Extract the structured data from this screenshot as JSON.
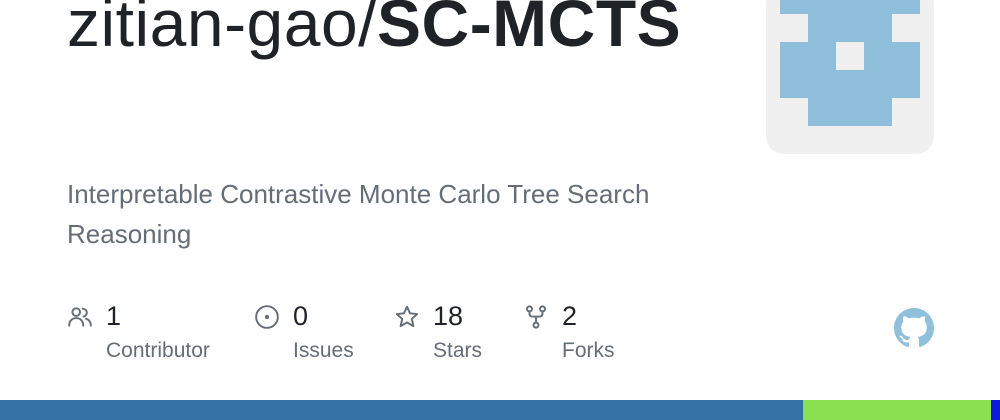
{
  "repo": {
    "owner": "zitian-gao/",
    "name": "SC-MCTS",
    "description": "Interpretable Contrastive Monte Carlo Tree Search Reasoning"
  },
  "avatar": {
    "icon": "identicon-avatar-icon",
    "color": "#8fbfda",
    "background": "#f0f0f0"
  },
  "stats": [
    {
      "icon": "people-icon",
      "value": "1",
      "label": "Contributor"
    },
    {
      "icon": "issue-icon",
      "value": "0",
      "label": "Issues"
    },
    {
      "icon": "star-icon",
      "value": "18",
      "label": "Stars"
    },
    {
      "icon": "fork-icon",
      "value": "2",
      "label": "Forks"
    }
  ],
  "github_logo": {
    "icon": "github-icon",
    "color": "#8fbfda"
  },
  "languages": [
    {
      "share": 0.803,
      "color": "#3572a5"
    },
    {
      "share": 0.188,
      "color": "#89e051"
    },
    {
      "share": 0.009,
      "color": "#0c1bd9"
    }
  ],
  "colors": {
    "title": "#1f2328",
    "muted": "#656d76",
    "icon": "#656d76"
  }
}
